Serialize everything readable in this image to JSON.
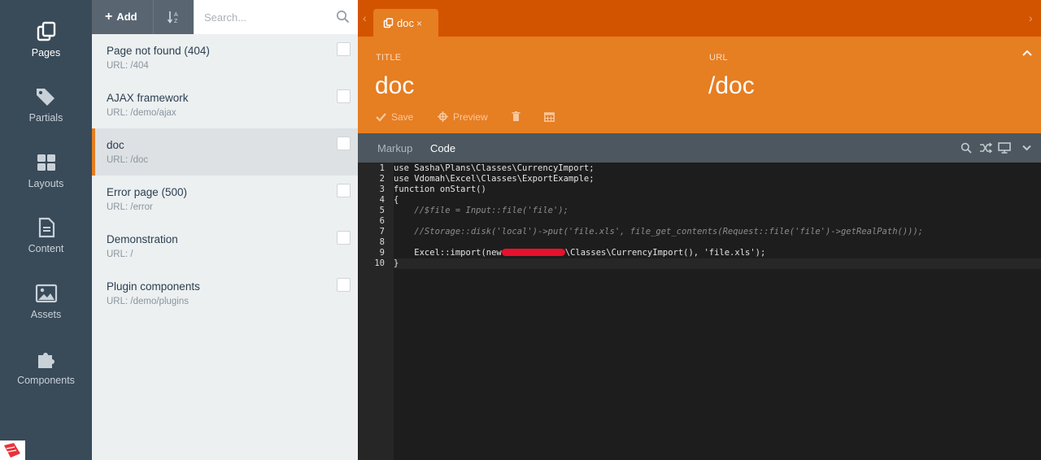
{
  "nav": {
    "items": [
      {
        "label": "Pages",
        "icon": "pages-icon"
      },
      {
        "label": "Partials",
        "icon": "tags-icon"
      },
      {
        "label": "Layouts",
        "icon": "layouts-icon"
      },
      {
        "label": "Content",
        "icon": "document-icon"
      },
      {
        "label": "Assets",
        "icon": "image-icon"
      },
      {
        "label": "Components",
        "icon": "puzzle-icon"
      }
    ],
    "active": "Pages"
  },
  "list": {
    "add_label": "Add",
    "search_placeholder": "Search...",
    "pages": [
      {
        "title": "Page not found (404)",
        "url": "URL: /404",
        "active": false
      },
      {
        "title": "AJAX framework",
        "url": "URL: /demo/ajax",
        "active": false
      },
      {
        "title": "doc",
        "url": "URL: /doc",
        "active": true
      },
      {
        "title": "Error page (500)",
        "url": "URL: /error",
        "active": false
      },
      {
        "title": "Demonstration",
        "url": "URL: /",
        "active": false
      },
      {
        "title": "Plugin components",
        "url": "URL: /demo/plugins",
        "active": false
      }
    ]
  },
  "editor": {
    "tab": {
      "label": "doc",
      "close": "×"
    },
    "title_label": "TITLE",
    "title_value": "doc",
    "url_label": "URL",
    "url_value": "/doc",
    "toolbar": {
      "save": "Save",
      "preview": "Preview"
    },
    "code_tabs": {
      "markup": "Markup",
      "code": "Code",
      "active": "Code"
    },
    "code_lines": [
      "use Sasha\\Plans\\Classes\\CurrencyImport;",
      "use Vdomah\\Excel\\Classes\\ExportExample;",
      "function onStart()",
      "{",
      "    //$file = Input::file('file');",
      "",
      "    //Storage::disk('local')->put('file.xls', file_get_contents(Request::file('file')->getRealPath()));",
      "",
      "    Excel::import(new",
      "}"
    ],
    "code_line9_tail": "\\Classes\\CurrencyImport(), 'file.xls');",
    "line_numbers": [
      "1",
      "2",
      "3",
      "4",
      "5",
      "6",
      "7",
      "8",
      "9",
      "10"
    ]
  },
  "colors": {
    "nav_bg": "#394a59",
    "accent": "#e67e22",
    "tabbar": "#d35400",
    "code_bg": "#1d1d1d"
  }
}
